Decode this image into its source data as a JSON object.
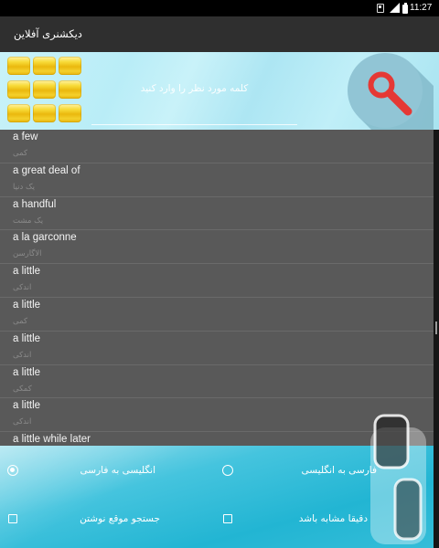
{
  "status_bar": {
    "time": "11:27",
    "icons": [
      "notification-icon",
      "signal-icon",
      "battery-icon"
    ]
  },
  "app_bar": {
    "title": "دیکشنری آفلاین"
  },
  "search": {
    "menu_icon": "grid-menu-icon",
    "placeholder": "کلمه مورد نظر را وارد کنید",
    "value": "",
    "button_icon": "search-icon"
  },
  "word_list": {
    "items": [
      {
        "word": "a few",
        "meaning": "کمی"
      },
      {
        "word": "a great deal of",
        "meaning": "یک دنیا"
      },
      {
        "word": "a handful",
        "meaning": "یک مشت"
      },
      {
        "word": "a la garconne",
        "meaning": "الاگارسن"
      },
      {
        "word": "a little",
        "meaning": "اندکی"
      },
      {
        "word": "a little",
        "meaning": "کمی"
      },
      {
        "word": "a little",
        "meaning": "اندکی"
      },
      {
        "word": "a little",
        "meaning": "کمکی"
      },
      {
        "word": "a little",
        "meaning": "اندکی"
      },
      {
        "word": "a little while later"
      }
    ]
  },
  "options": {
    "direction": [
      {
        "label": "انگلیسی به فارسی",
        "selected": true
      },
      {
        "label": "فارسی به انگلیسی",
        "selected": false
      }
    ],
    "filters": [
      {
        "label": "جستجو موقع نوشتن",
        "checked": false
      },
      {
        "label": "دقیقا مشابه باشد",
        "checked": false
      }
    ]
  },
  "colors": {
    "app_bar": "#2f2f2f",
    "list_background": "#595959",
    "accent": "#22b5d3",
    "search_button": "#91c5d5",
    "search_icon": "#e53935",
    "menu_tiles": "#eab80e"
  }
}
